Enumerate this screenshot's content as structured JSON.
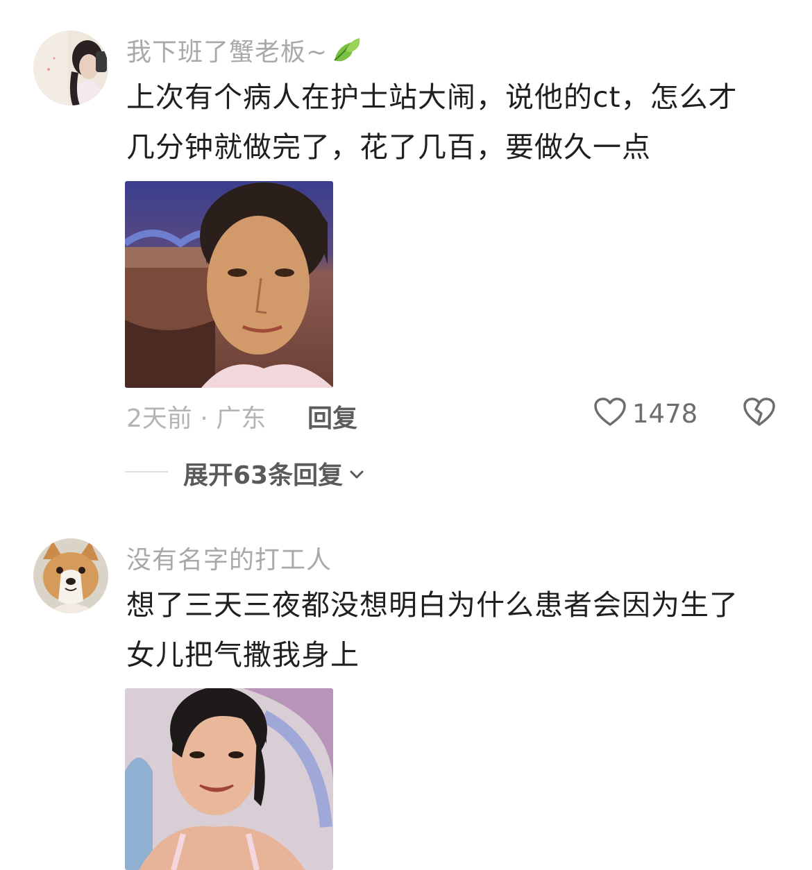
{
  "comments": [
    {
      "username": "我下班了蟹老板~",
      "text_line1": "上次有个病人在护士站大闹，说他的ct，怎么才",
      "text_line2": "几分钟就做完了，花了几百，要做久一点",
      "meta": "2天前 · 广东",
      "reply_label": "回复",
      "likes": "1478",
      "expand_label": "展开63条回复"
    },
    {
      "username": "没有名字的打工人",
      "text_line1": "想了三天三夜都没想明白为什么患者会因为生了",
      "text_line2": "女儿把气撒我身上"
    }
  ],
  "icons": {
    "like": "heart-outline-icon",
    "dislike": "broken-heart-icon",
    "expand": "chevron-down-icon",
    "leaf": "leaf-emoji-icon"
  }
}
